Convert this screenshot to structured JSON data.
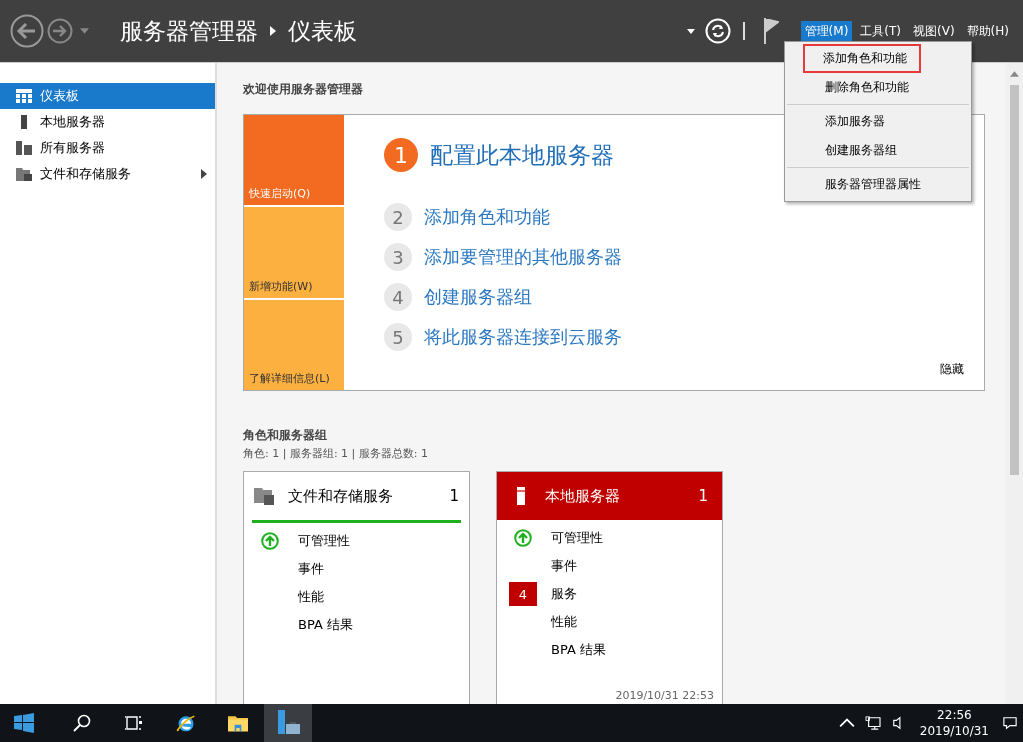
{
  "header": {
    "title": "服务器管理器",
    "page": "仪表板"
  },
  "menu": [
    {
      "label": "管理(M)",
      "selected": true
    },
    {
      "label": "工具(T)",
      "selected": false
    },
    {
      "label": "视图(V)",
      "selected": false
    },
    {
      "label": "帮助(H)",
      "selected": false
    }
  ],
  "dropdown": {
    "groups": [
      [
        {
          "label": "添加角色和功能",
          "highlighted": true
        },
        {
          "label": "删除角色和功能",
          "highlighted": false
        }
      ],
      [
        {
          "label": "添加服务器",
          "highlighted": false
        },
        {
          "label": "创建服务器组",
          "highlighted": false
        }
      ],
      [
        {
          "label": "服务器管理器属性",
          "highlighted": false
        }
      ]
    ]
  },
  "sidebar": {
    "items": [
      {
        "label": "仪表板",
        "kind": "dashboard",
        "selected": true,
        "expandable": false
      },
      {
        "label": "本地服务器",
        "kind": "server",
        "selected": false,
        "expandable": false
      },
      {
        "label": "所有服务器",
        "kind": "servers",
        "selected": false,
        "expandable": false
      },
      {
        "label": "文件和存储服务",
        "kind": "files",
        "selected": false,
        "expandable": true
      }
    ]
  },
  "welcome": {
    "title": "欢迎使用服务器管理器",
    "tiles": [
      {
        "label": "快速启动(Q)",
        "selected": true
      },
      {
        "label": "新增功能(W)",
        "selected": false
      },
      {
        "label": "了解详细信息(L)",
        "selected": false
      }
    ],
    "steps": [
      {
        "number": "1",
        "label": "配置此本地服务器",
        "kind": "primary"
      },
      {
        "number": "2",
        "label": "添加角色和功能",
        "kind": "secondary"
      },
      {
        "number": "3",
        "label": "添加要管理的其他服务器",
        "kind": "secondary"
      },
      {
        "number": "4",
        "label": "创建服务器组",
        "kind": "secondary"
      },
      {
        "number": "5",
        "label": "将此服务器连接到云服务",
        "kind": "secondary"
      }
    ],
    "hide": "隐藏"
  },
  "roles": {
    "title": "角色和服务器组",
    "summary": "角色: 1 | 服务器组: 1 | 服务器总数: 1",
    "cards": [
      {
        "title": "文件和存储服务",
        "count": "1",
        "kind": "files",
        "alert": false,
        "rows": [
          {
            "label": "可管理性",
            "kind": "ok"
          },
          {
            "label": "事件",
            "kind": "plain"
          },
          {
            "label": "性能",
            "kind": "plain"
          },
          {
            "label": "BPA 结果",
            "kind": "plain"
          }
        ]
      },
      {
        "title": "本地服务器",
        "count": "1",
        "kind": "server",
        "alert": true,
        "timestamp": "2019/10/31 22:53",
        "rows": [
          {
            "label": "可管理性",
            "kind": "ok"
          },
          {
            "label": "事件",
            "kind": "plain"
          },
          {
            "label": "服务",
            "kind": "badge",
            "badge": "4"
          },
          {
            "label": "性能",
            "kind": "plain"
          },
          {
            "label": "BPA 结果",
            "kind": "plain"
          }
        ]
      }
    ]
  },
  "taskbar": {
    "time": "22:56",
    "date": "2019/10/31"
  }
}
